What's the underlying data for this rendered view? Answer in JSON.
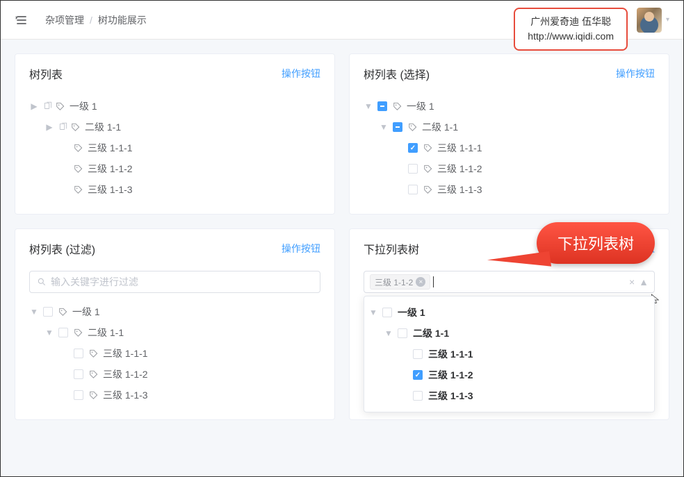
{
  "breadcrumb": {
    "part1": "杂项管理",
    "part2": "树功能展示"
  },
  "attribution": {
    "line1": "广州爱奇迪 伍华聪",
    "line2": "http://www.iqidi.com"
  },
  "common": {
    "action_label": "操作按钮"
  },
  "filter": {
    "placeholder": "输入关键字进行过滤"
  },
  "dropdown_select": {
    "selected_tag": "三级 1-1-2"
  },
  "cards": {
    "tree_list": {
      "title": "树列表"
    },
    "tree_select": {
      "title": "树列表 (选择)"
    },
    "tree_filter": {
      "title": "树列表 (过滤)"
    },
    "tree_dropdown": {
      "title": "下拉列表树"
    }
  },
  "tree_nodes": {
    "lvl1": "一级 1",
    "lvl2": "二级 1-1",
    "lvl3_1": "三级 1-1-1",
    "lvl3_2": "三级 1-1-2",
    "lvl3_3": "三级 1-1-3"
  },
  "callout": {
    "text": "下拉列表树"
  },
  "colors": {
    "primary": "#409eff",
    "callout": "#ff5544",
    "attribution_border": "#e74c3c"
  }
}
